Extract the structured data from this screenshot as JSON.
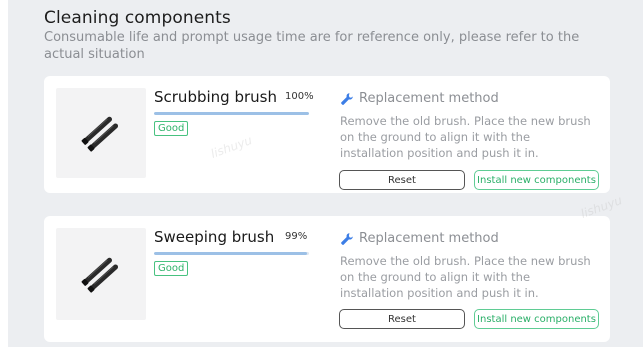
{
  "header": {
    "title": "Cleaning components",
    "subtitle": "Consumable life and prompt usage time are for reference only, please refer to the actual situation"
  },
  "components": [
    {
      "name": "Scrubbing brush",
      "percent_label": "100%",
      "remaining_fraction": 1.0,
      "status": "Good",
      "image_icon": "brush-icon",
      "method_icon": "wrench-icon",
      "method_title": "Replacement method",
      "method_description": "Remove the old brush. Place the new brush on the ground to align it with the installation position and push it in.",
      "reset_label": "Reset",
      "install_label": "Install new components"
    },
    {
      "name": "Sweeping brush",
      "percent_label": "99%",
      "remaining_fraction": 0.99,
      "status": "Good",
      "image_icon": "brush-icon",
      "method_icon": "wrench-icon",
      "method_title": "Replacement method",
      "method_description": "Remove the old brush. Place the new brush on the ground to align it with the installation position and push it in.",
      "reset_label": "Reset",
      "install_label": "Install new components"
    }
  ],
  "watermark": "lishuyu",
  "colors": {
    "background": "#eceef1",
    "progress_fill": "#9cc0e6",
    "good_green": "#2db36a",
    "install_border": "#5fcc94",
    "method_blue": "#3d7ee6"
  }
}
